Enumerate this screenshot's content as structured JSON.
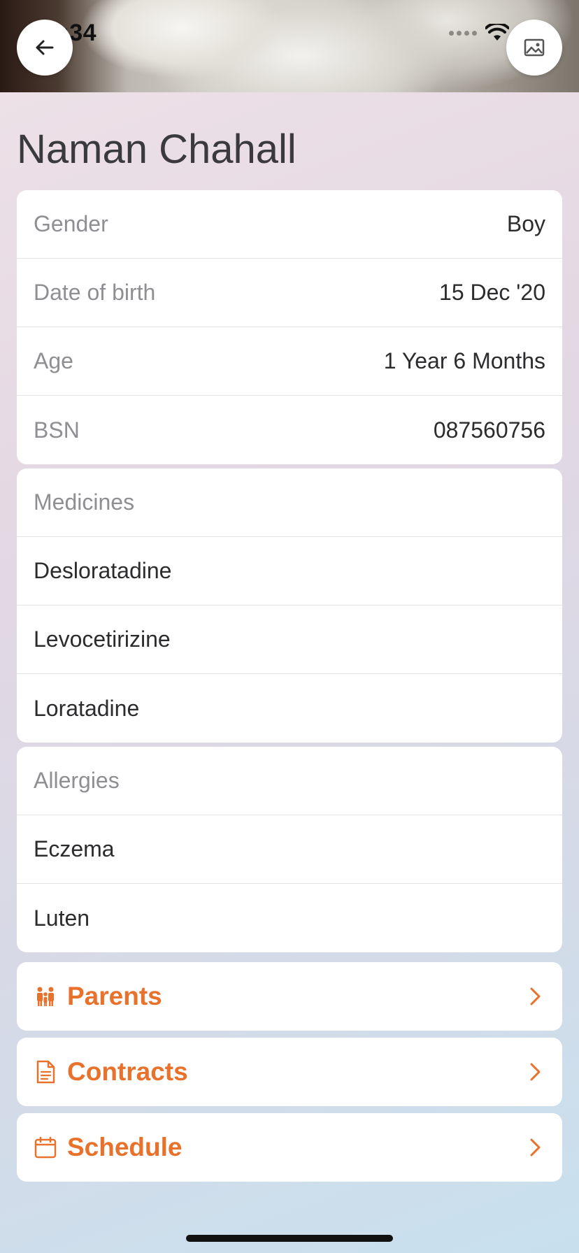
{
  "status_bar": {
    "time": "3:34"
  },
  "header": {
    "title": "Naman Chahall"
  },
  "details": [
    {
      "label": "Gender",
      "value": "Boy"
    },
    {
      "label": "Date of birth",
      "value": "15 Dec '20"
    },
    {
      "label": "Age",
      "value": "1 Year 6 Months"
    },
    {
      "label": "BSN",
      "value": "087560756"
    }
  ],
  "medicines": {
    "title": "Medicines",
    "items": [
      "Desloratadine",
      "Levocetirizine",
      "Loratadine"
    ]
  },
  "allergies": {
    "title": "Allergies",
    "items": [
      "Eczema",
      "Luten"
    ]
  },
  "links": [
    {
      "label": "Parents",
      "icon": "family-icon"
    },
    {
      "label": "Contracts",
      "icon": "document-icon"
    },
    {
      "label": "Schedule",
      "icon": "calendar-icon"
    }
  ],
  "colors": {
    "accent": "#e8722c",
    "text": "#2c2c2e",
    "muted": "#8e8e93"
  }
}
